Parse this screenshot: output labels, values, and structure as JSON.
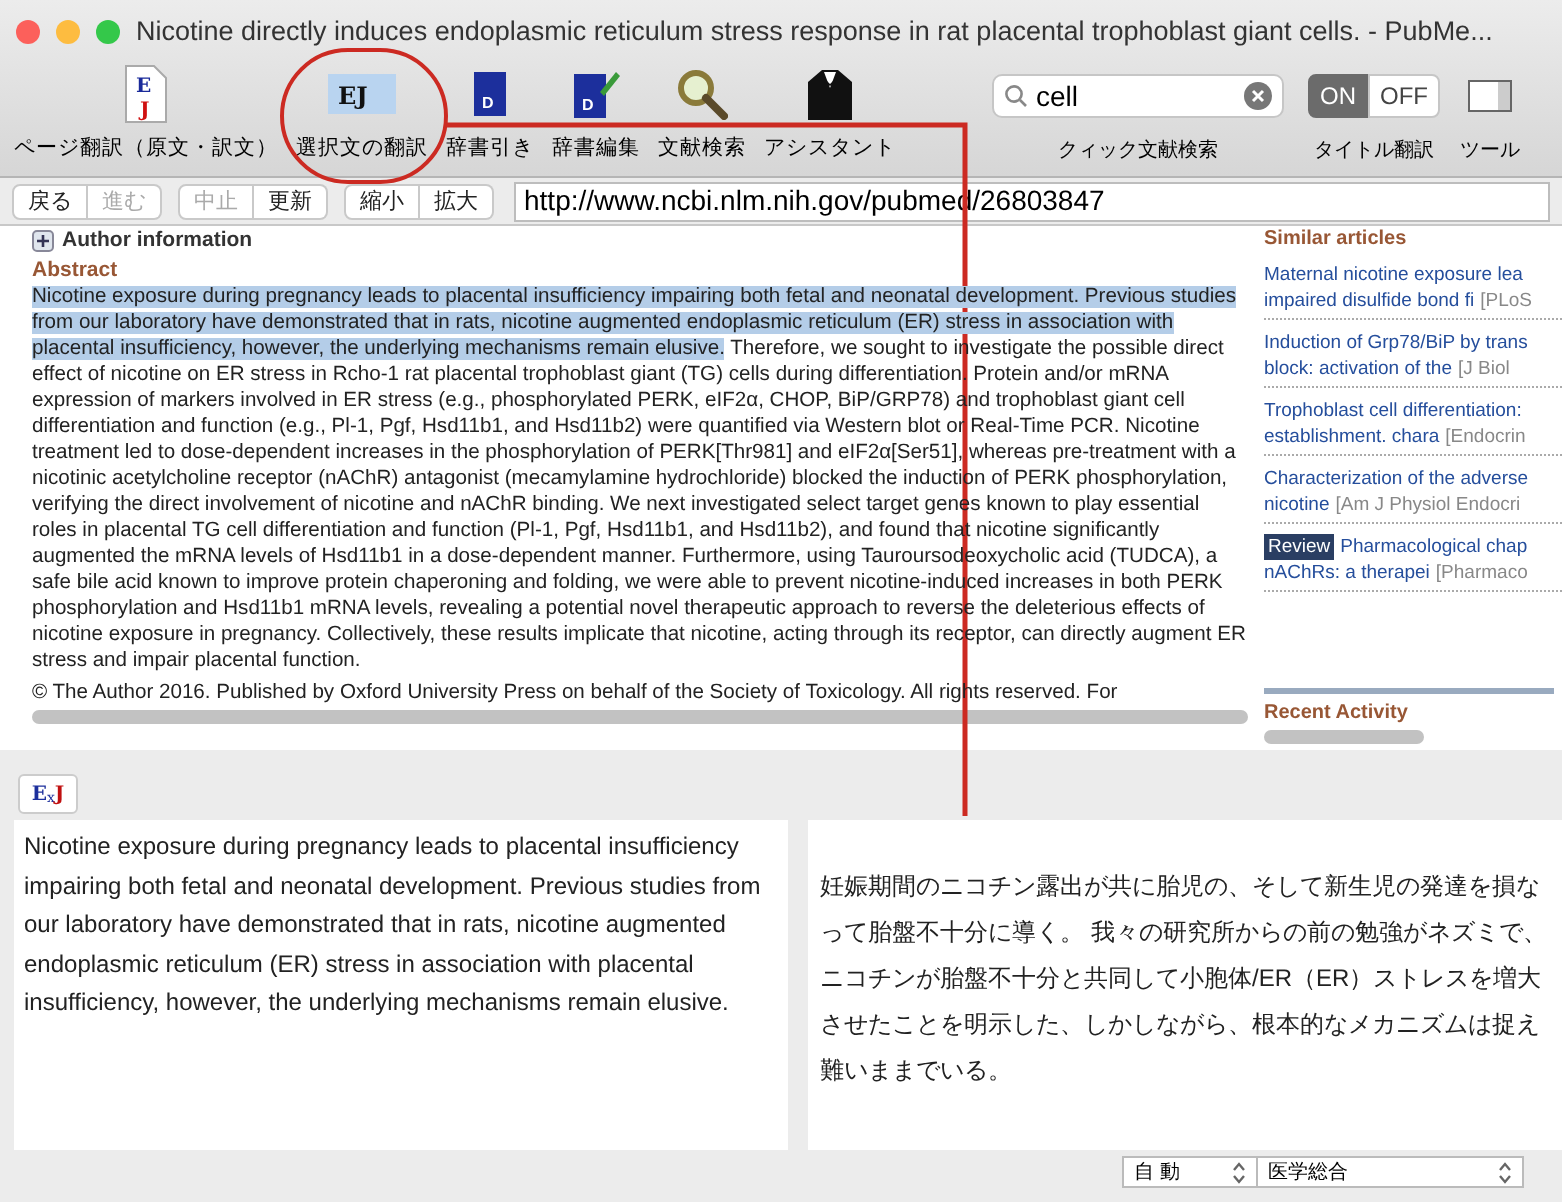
{
  "window": {
    "title": "Nicotine directly induces endoplasmic reticulum stress response in rat placental trophoblast giant cells. - PubMe..."
  },
  "toolbar": {
    "tools": [
      {
        "kind": "page",
        "icon_letters": [
          "E",
          "J"
        ],
        "label": "ページ翻訳（原文・訳文）"
      },
      {
        "kind": "selection",
        "icon_letters": [
          "EJ"
        ],
        "label": "選択文の翻訳"
      },
      {
        "kind": "dictionary",
        "icon_letters": [
          "D"
        ],
        "label": "辞書引き"
      },
      {
        "kind": "dict-edit",
        "icon_letters": [
          "D"
        ],
        "label": "辞書編集"
      },
      {
        "kind": "search",
        "label": "文献検索"
      },
      {
        "kind": "assistant",
        "label": "アシスタント"
      }
    ],
    "quick_search": {
      "value": "cell",
      "label": "クィック文献検索"
    },
    "title_translation": {
      "options": [
        {
          "label": "ON",
          "selected": true
        },
        {
          "label": "OFF",
          "selected": false
        }
      ],
      "label": "タイトル翻訳"
    },
    "tools_label": "ツール"
  },
  "nav": {
    "groups": [
      [
        {
          "label": "戻る",
          "disabled": false
        },
        {
          "label": "進む",
          "disabled": true
        }
      ],
      [
        {
          "label": "中止",
          "disabled": true
        },
        {
          "label": "更新",
          "disabled": false
        }
      ],
      [
        {
          "label": "縮小",
          "disabled": false
        },
        {
          "label": "拡大",
          "disabled": false
        }
      ]
    ],
    "url": "http://www.ncbi.nlm.nih.gov/pubmed/26803847"
  },
  "article": {
    "author_information": "Author information",
    "abstract_heading": "Abstract",
    "abstract": [
      {
        "text": "Nicotine exposure during pregnancy leads to placental insufficiency impairing both fetal and neonatal development. Previous studies from our laboratory have demonstrated that in rats, nicotine augmented endoplasmic reticulum (ER) stress in association with placental insufficiency, however, the underlying mechanisms remain elusive.",
        "selected": true
      },
      {
        "text": " Therefore, we sought to investigate the possible direct effect of nicotine on ER stress in Rcho-1 rat placental trophoblast giant (TG) cells during differentiation. Protein and/or mRNA expression of markers involved in ER stress (e.g., phosphorylated PERK, eIF2α, CHOP, BiP/GRP78) and trophoblast giant cell differentiation and function (e.g., Pl-1, Pgf, Hsd11b1, and Hsd11b2) were quantified via Western blot or Real-Time PCR. Nicotine treatment led to dose-dependent increases in the phosphorylation of PERK[Thr981] and eIF2α[Ser51], whereas pre-treatment with a nicotinic acetylcholine receptor (nAChR) antagonist (mecamylamine hydrochloride) blocked the induction of PERK phosphorylation, verifying the direct involvement of nicotine and nAChR binding. We next investigated select target genes known to play essential roles in placental TG cell differentiation and function (Pl-1, Pgf, Hsd11b1, and Hsd11b2), and found that nicotine significantly augmented the mRNA levels of Hsd11b1 in a dose-dependent manner. Furthermore, using Tauroursodeoxycholic acid (TUDCA), a safe bile acid known to improve protein chaperoning and folding, we were able to prevent nicotine-induced increases in both PERK phosphorylation and Hsd11b1 mRNA levels, revealing a potential novel therapeutic approach to reverse the deleterious effects of nicotine exposure in pregnancy. Collectively, these results implicate that nicotine, acting through its receptor, can directly augment ER stress and impair placental function.",
        "selected": false
      }
    ],
    "copyright": "© The Author 2016. Published by Oxford University Press on behalf of the Society of Toxicology. All rights reserved. For"
  },
  "sidebar": {
    "heading": "Similar articles",
    "items": [
      {
        "line1": "Maternal nicotine exposure lea",
        "line2": "impaired disulfide bond fi",
        "journal": "[PLoS"
      },
      {
        "line1": "Induction of Grp78/BiP by trans",
        "line2": "block: activation of the",
        "journal": "[J Biol"
      },
      {
        "line1": "Trophoblast cell differentiation:",
        "line2": "establishment. chara",
        "journal": "[Endocrin"
      },
      {
        "line1": "Characterization of the adverse",
        "line2": "nicotine",
        "journal": "[Am J Physiol Endocri"
      },
      {
        "badge": "Review",
        "line1": "Pharmacological chap",
        "line2": "nAChRs: a therapei",
        "journal": "[Pharmaco"
      }
    ],
    "recent_heading": "Recent Activity"
  },
  "translation": {
    "button_letters": [
      "E",
      "x",
      "J"
    ],
    "source": "Nicotine exposure during pregnancy leads to placental insufficiency impairing both fetal and neonatal development. Previous studies from our laboratory have demonstrated that in rats, nicotine augmented endoplasmic reticulum (ER) stress in association with placental insufficiency, however, the underlying mechanisms remain elusive.",
    "target": "妊娠期間のニコチン露出が共に胎児の、そして新生児の発達を損なって胎盤不十分に導く。 我々の研究所からの前の勉強がネズミで、ニコチンが胎盤不十分と共同して小胞体/ER（ER）ストレスを増大させたことを明示した、しかしながら、根本的なメカニズムは捉え難いままでいる。",
    "mode": "自 動",
    "field": "医学総合"
  }
}
